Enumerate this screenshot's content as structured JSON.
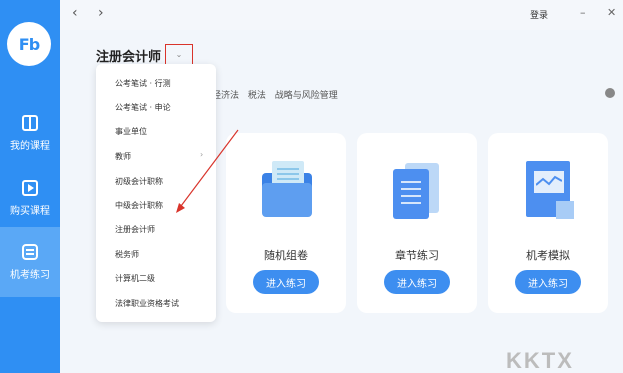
{
  "sidebar": {
    "logo": "Fb",
    "items": [
      {
        "label": "我的课程",
        "icon": "book-icon",
        "active": false
      },
      {
        "label": "购买课程",
        "icon": "play-icon",
        "active": false
      },
      {
        "label": "机考练习",
        "icon": "exam-icon",
        "active": true
      }
    ]
  },
  "topbar": {
    "back": "‹",
    "forward": "›",
    "login": "登录",
    "minimize": "–",
    "close": "✕"
  },
  "heading": {
    "title": "注册会计师",
    "toggle": "⌄"
  },
  "categories": {
    "items": [
      "经济法",
      "税法",
      "战略与风险管理"
    ]
  },
  "dropdown": {
    "items": [
      "公考笔试 · 行测",
      "公考笔试 · 申论",
      "事业单位",
      "教师",
      "初级会计职称",
      "中级会计职称",
      "注册会计师",
      "税务师",
      "计算机二级",
      "法律职业资格考试"
    ],
    "chevron": "›"
  },
  "cards": [
    {
      "title": "随机组卷",
      "button": "进入练习",
      "illustration": "folder-icon"
    },
    {
      "title": "章节练习",
      "button": "进入练习",
      "illustration": "documents-icon"
    },
    {
      "title": "机考模拟",
      "button": "进入练习",
      "illustration": "chart-document-icon"
    }
  ],
  "colors": {
    "sidebar": "#2f8ff3",
    "accent": "#3d8ef0",
    "annotation": "#d9342b"
  },
  "watermark": "KKTX"
}
